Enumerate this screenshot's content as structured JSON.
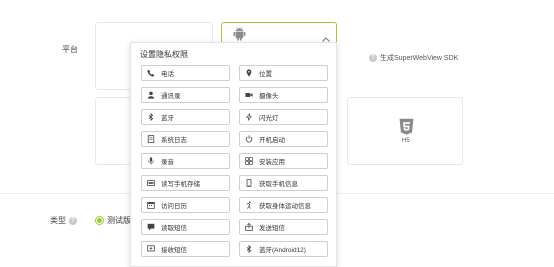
{
  "platform": {
    "label": "平台"
  },
  "super_webview": {
    "label": "生成SuperWebView SDK"
  },
  "h5": {
    "label": "H5"
  },
  "type": {
    "label": "类型",
    "radio_label": "测试版"
  },
  "popup": {
    "title": "设置隐私权限",
    "left": [
      {
        "label": "电话",
        "icon": "phone-icon"
      },
      {
        "label": "通讯录",
        "icon": "contacts-icon"
      },
      {
        "label": "蓝牙",
        "icon": "bluetooth-icon"
      },
      {
        "label": "系统日志",
        "icon": "system-log-icon"
      },
      {
        "label": "录音",
        "icon": "microphone-icon"
      },
      {
        "label": "读写手机存储",
        "icon": "storage-icon"
      },
      {
        "label": "访问日历",
        "icon": "calendar-icon"
      },
      {
        "label": "读取短信",
        "icon": "sms-read-icon"
      },
      {
        "label": "接收短信",
        "icon": "sms-receive-icon"
      }
    ],
    "right": [
      {
        "label": "位置",
        "icon": "location-icon"
      },
      {
        "label": "摄像头",
        "icon": "camera-icon"
      },
      {
        "label": "闪光灯",
        "icon": "flashlight-icon"
      },
      {
        "label": "开机启动",
        "icon": "power-icon"
      },
      {
        "label": "安装应用",
        "icon": "apps-icon"
      },
      {
        "label": "获取手机信息",
        "icon": "phone-info-icon"
      },
      {
        "label": "获取身体运动信息",
        "icon": "activity-icon"
      },
      {
        "label": "发送短信",
        "icon": "sms-send-icon"
      },
      {
        "label": "蓝牙(Android12)",
        "icon": "bluetooth-android12-icon"
      }
    ]
  }
}
